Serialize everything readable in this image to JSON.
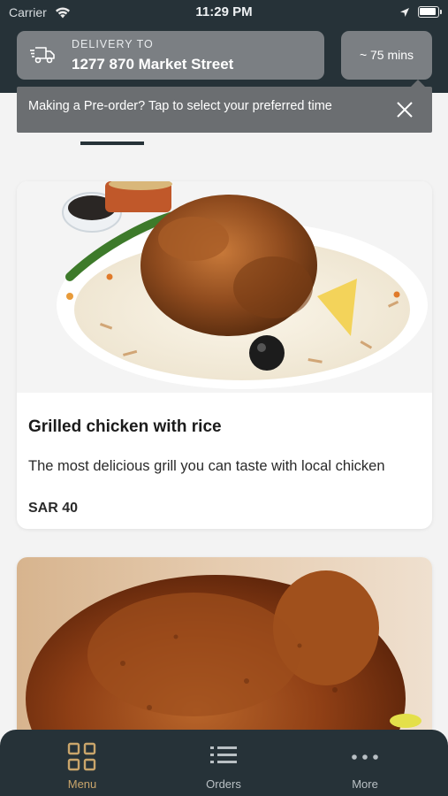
{
  "status_bar": {
    "carrier": "Carrier",
    "time": "11:29 PM"
  },
  "delivery": {
    "label": "DELIVERY TO",
    "address": "1277 870 Market Street",
    "icon": "truck-icon"
  },
  "eta": {
    "label": "~ 75 mins"
  },
  "tooltip": {
    "text": "Making a Pre-order? Tap to select your preferred time",
    "close_icon": "close-icon"
  },
  "products": [
    {
      "title": "Grilled chicken with rice",
      "description": "The most delicious grill you can taste with local chicken",
      "price": "SAR 40"
    },
    {
      "title": "",
      "description": "",
      "price": ""
    }
  ],
  "bottom_nav": {
    "items": [
      {
        "label": "Menu",
        "icon": "grid-icon",
        "active": true
      },
      {
        "label": "Orders",
        "icon": "list-icon",
        "active": false
      },
      {
        "label": "More",
        "icon": "more-icon",
        "active": false
      }
    ]
  },
  "colors": {
    "header_bg": "#263238",
    "pill_bg": "#7b7f83",
    "tooltip_bg": "#6b6e71",
    "active_accent": "#c9a56b",
    "inactive_nav": "#b9c0c4",
    "page_bg": "#f3f3f3"
  }
}
